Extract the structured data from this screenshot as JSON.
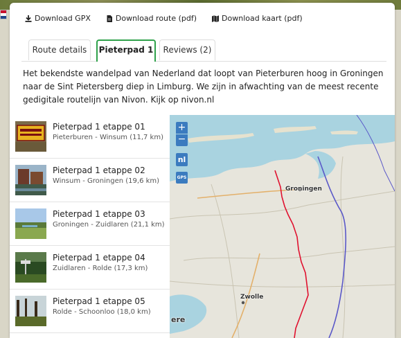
{
  "downloads": [
    {
      "label": "Download GPX",
      "icon": "download-icon"
    },
    {
      "label": "Download route (pdf)",
      "icon": "file-icon"
    },
    {
      "label": "Download kaart (pdf)",
      "icon": "map-icon"
    }
  ],
  "tabs": [
    {
      "label": "Route details",
      "active": false
    },
    {
      "label": "Pieterpad 1",
      "active": true
    },
    {
      "label": "Reviews (2)",
      "active": false
    }
  ],
  "intro": "Het bekendste wandelpad van Nederland dat loopt van Pieterburen hoog in Groningen naar de Sint Pietersberg diep in Limburg. We zijn in afwachting van de meest recente gedigitale routelijn van Nivon. Kijk op nivon.nl",
  "stages": [
    {
      "title": "Pieterpad 1 etappe 01",
      "sub": "Pieterburen - Winsum (11,7 km)"
    },
    {
      "title": "Pieterpad 1 etappe 02",
      "sub": "Winsum - Groningen (19,6 km)"
    },
    {
      "title": "Pieterpad 1 etappe 03",
      "sub": "Groningen - Zuidlaren (21,1 km)"
    },
    {
      "title": "Pieterpad 1 etappe 04",
      "sub": "Zuidlaren - Rolde (17,3 km)"
    },
    {
      "title": "Pieterpad 1 etappe 05",
      "sub": "Rolde - Schoonloo (18,0 km)"
    }
  ],
  "map": {
    "zoom_in": "+",
    "zoom_out": "−",
    "nl": "nl",
    "gps": "GPS",
    "labels": {
      "groningen": "Groningen",
      "zwolle": "Zwolle",
      "partial": "ere"
    }
  },
  "colors": {
    "accent": "#2ea14a",
    "map_control": "#3b7bbf",
    "route": "#e0102e",
    "water": "#a9d3e0"
  }
}
